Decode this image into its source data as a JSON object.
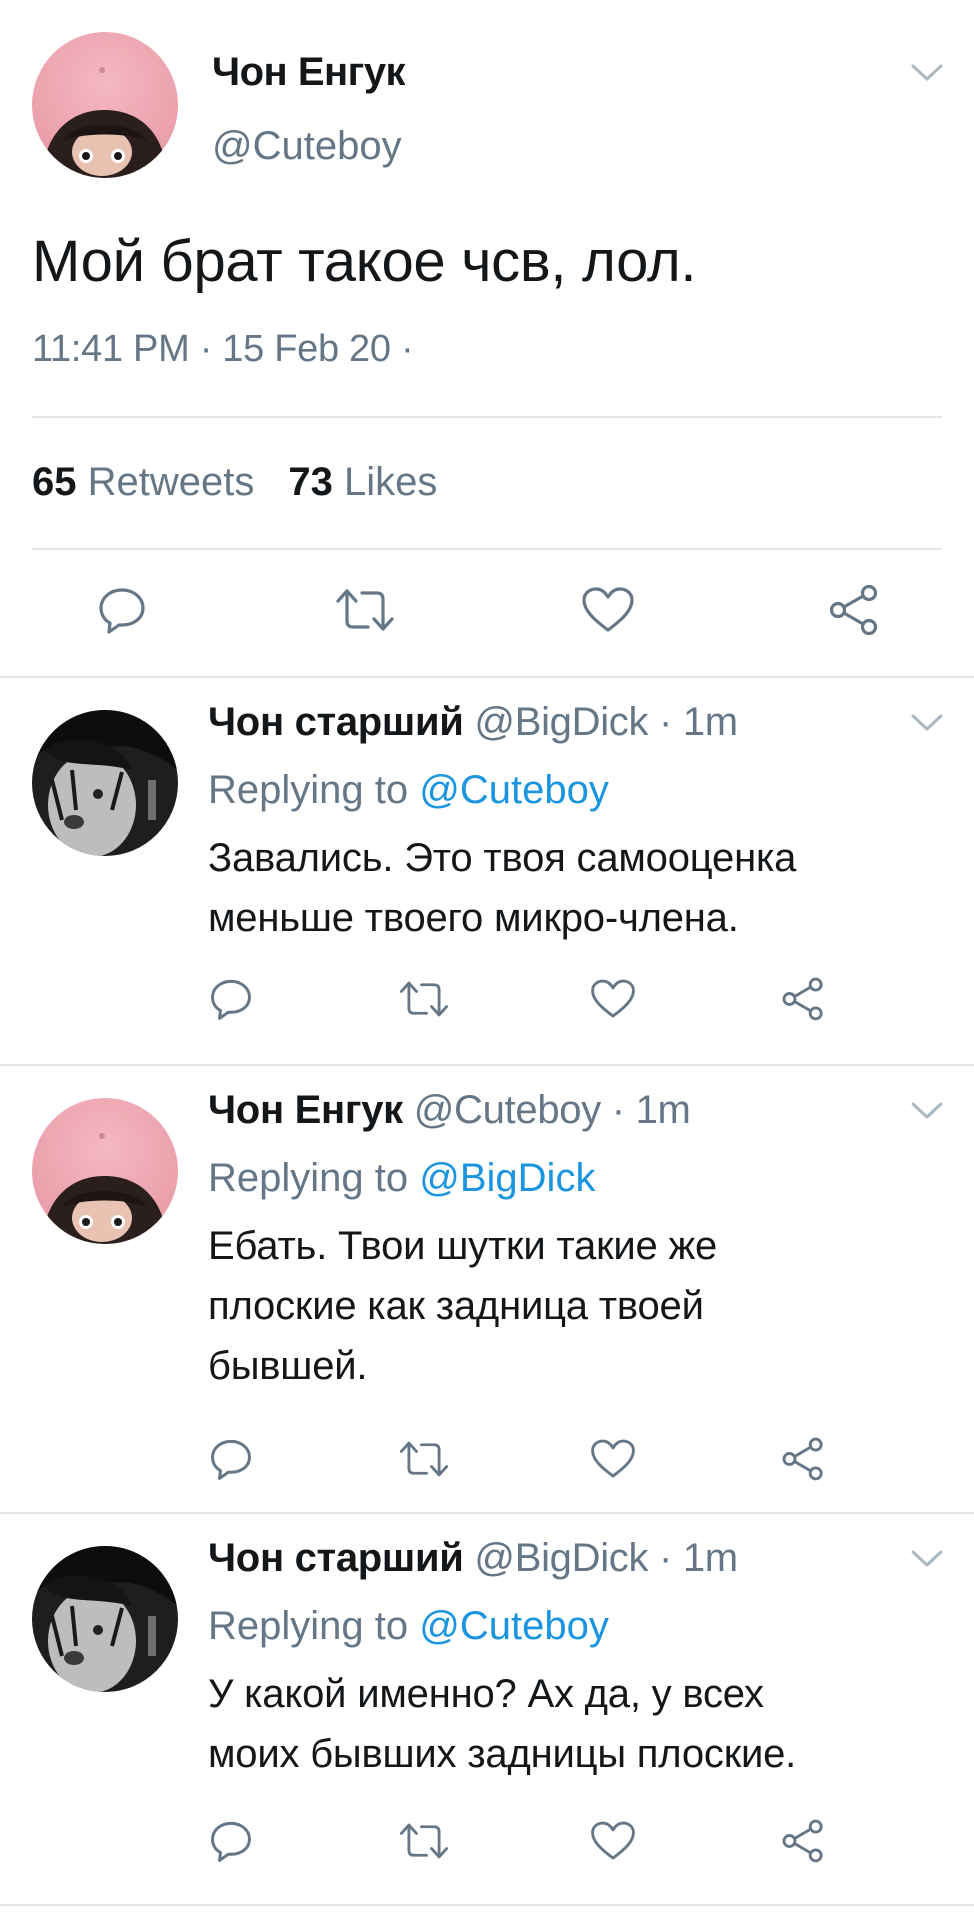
{
  "main_tweet": {
    "author_name": "Чон Енгук",
    "author_handle": "@Cuteboy",
    "text": "Мой брат такое чсв, лол.",
    "meta": "11:41 PM · 15 Feb 20 ·",
    "retweets_count": "65",
    "retweets_label": "Retweets",
    "likes_count": "73",
    "likes_label": "Likes"
  },
  "icons": {
    "reply": "reply-icon",
    "retweet": "retweet-icon",
    "like": "heart-icon",
    "share": "share-icon",
    "more": "chevron-down-icon"
  },
  "colors": {
    "text": "#14171a",
    "muted": "#657786",
    "link": "#1b95e0",
    "divider": "#e1e8ed"
  },
  "replies": [
    {
      "name": "Чон старший",
      "handle": "@BigDick",
      "time": "· 1m",
      "replying_label": "Replying to",
      "replying_to": "@Cuteboy",
      "lines": [
        "Завались. Это твоя самооценка",
        "меньше твоего микро-члена."
      ]
    },
    {
      "name": "Чон Енгук",
      "handle": "@Cuteboy",
      "time": "· 1m",
      "replying_label": "Replying to",
      "replying_to": "@BigDick",
      "lines": [
        "Ебать. Твои шутки такие же",
        "плоские как задница твоей",
        "бывшей."
      ]
    },
    {
      "name": "Чон старший",
      "handle": "@BigDick",
      "time": "· 1m",
      "replying_label": "Replying to",
      "replying_to": "@Cuteboy",
      "lines": [
        "У какой именно? Ах да, у всех",
        "моих бывших задницы плоские."
      ]
    }
  ]
}
